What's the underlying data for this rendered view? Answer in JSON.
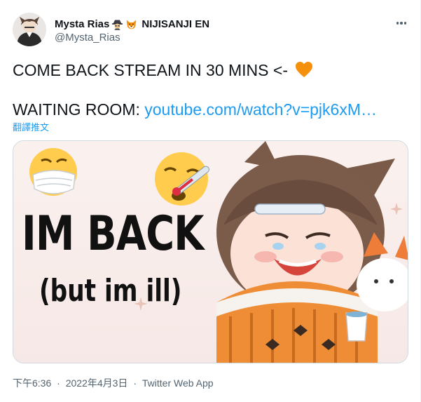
{
  "author": {
    "display_name": "Mysta Rias",
    "affiliation": "NIJISANJI EN",
    "handle": "@Mysta_Rias",
    "badge_icons": [
      "detective-icon",
      "fox-icon"
    ]
  },
  "tweet": {
    "line1": "COME BACK STREAM IN 30 MINS <-",
    "line2_prefix": "WAITING ROOM: ",
    "link_text": "youtube.com/watch?v=pjk6xM…",
    "translate_label": "翻譯推文"
  },
  "media": {
    "title_text": "IM BACK",
    "subtitle_text": "(but im ill)"
  },
  "footer": {
    "time": "下午6:36",
    "separator": "·",
    "date": "2022年4月3日",
    "source": "Twitter Web App"
  },
  "colors": {
    "link": "#1d9bf0",
    "secondary_text": "#536471",
    "heart": "#f4900c"
  }
}
